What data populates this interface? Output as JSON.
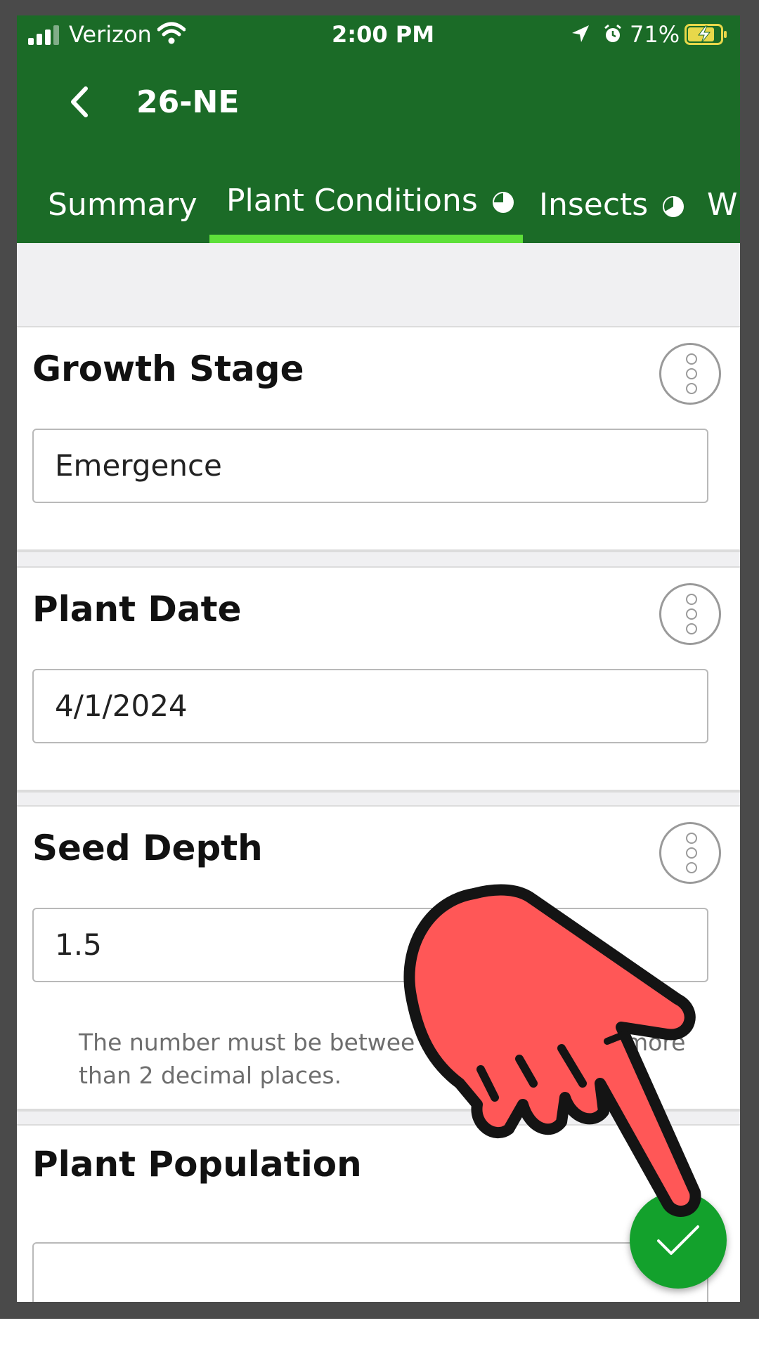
{
  "status_bar": {
    "carrier": "Verizon",
    "time": "2:00 PM",
    "battery_percent": "71%"
  },
  "header": {
    "title": "26-NE",
    "tabs": [
      {
        "label": "Summary"
      },
      {
        "label": "Plant Conditions",
        "selected": true
      },
      {
        "label": "Insects"
      },
      {
        "label": "W"
      }
    ]
  },
  "cards": {
    "growth_stage": {
      "label": "Growth Stage",
      "value": "Emergence"
    },
    "plant_date": {
      "label": "Plant Date",
      "value": "4/1/2024"
    },
    "seed_depth": {
      "label": "Seed Depth",
      "value": "1.5",
      "help_line1": "The number must be betwee",
      "help_line1_end": "more",
      "help_line2": "than 2 decimal places."
    },
    "plant_population": {
      "label": "Plant Population",
      "value": ""
    }
  },
  "colors": {
    "header_green": "#1b6b27",
    "tab_indicator": "#5ee03a",
    "fab_green": "#13a12c",
    "pointer_hand": "#ff5757"
  },
  "icons": [
    "back-chevron-icon",
    "more-vertical-icon",
    "checkmark-icon",
    "pie-progress-icon",
    "pointing-hand-icon"
  ]
}
